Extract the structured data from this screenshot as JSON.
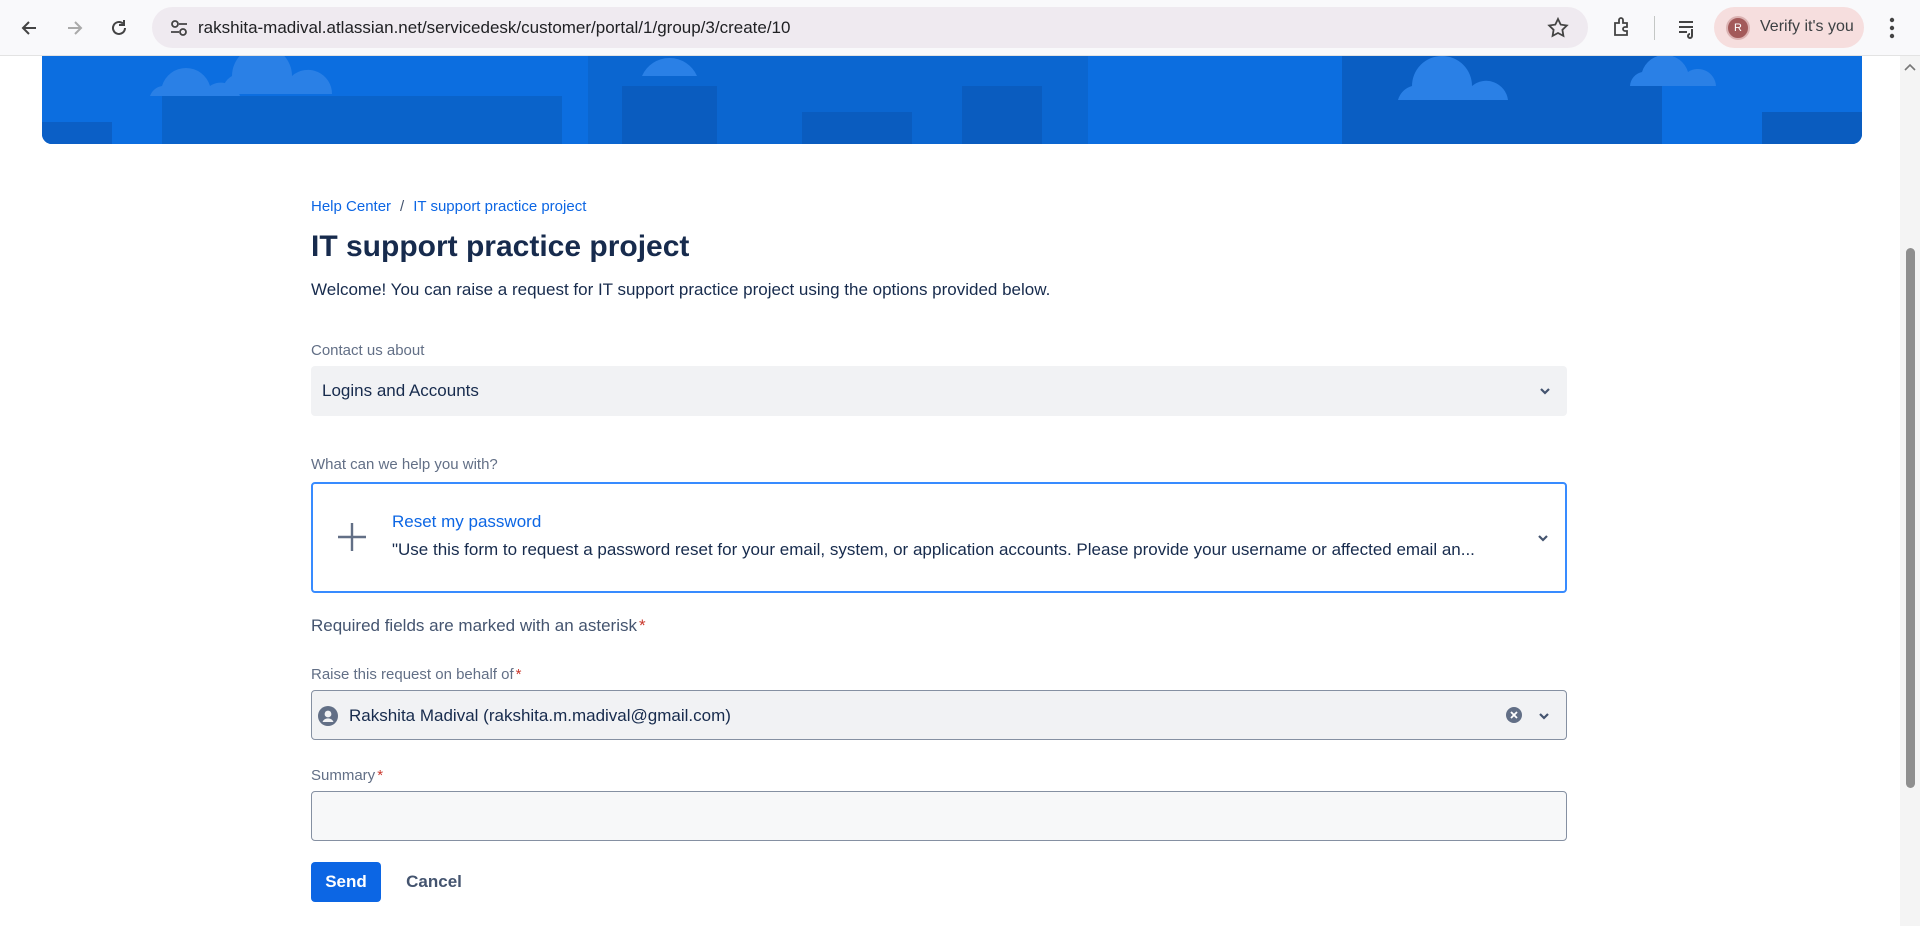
{
  "browser": {
    "url": "rakshita-madival.atlassian.net/servicedesk/customer/portal/1/group/3/create/10",
    "profile_initial": "R",
    "profile_label": "Verify it's you"
  },
  "breadcrumb": {
    "home": "Help Center",
    "separator": "/",
    "project": "IT support practice project"
  },
  "page": {
    "title": "IT support practice project",
    "welcome": "Welcome! You can raise a request for IT support practice project using the options provided below."
  },
  "form": {
    "contact_label": "Contact us about",
    "contact_value": "Logins and Accounts",
    "help_label": "What can we help you with?",
    "request_type": {
      "title": "Reset my password",
      "description": "\"Use this form to request a password reset for your email, system, or application accounts. Please provide your username or affected email an..."
    },
    "required_note": "Required fields are marked with an asterisk",
    "asterisk": "*",
    "behalf_label": "Raise this request on behalf of",
    "behalf_value": "Rakshita Madival (rakshita.m.madival@gmail.com)",
    "summary_label": "Summary",
    "summary_value": "",
    "send_label": "Send",
    "cancel_label": "Cancel"
  },
  "colors": {
    "brand_blue": "#0c66e4",
    "banner_blue": "#0c6ee0",
    "required_red": "#c9372c"
  }
}
